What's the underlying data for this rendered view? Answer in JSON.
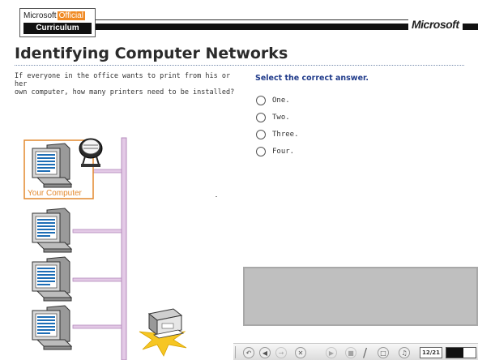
{
  "header": {
    "brand_top_ms": "Microsoft",
    "brand_top_official": "Official",
    "brand_curriculum": "Curriculum",
    "ms_logo": "Microsoft"
  },
  "page_title": "Identifying Computer Networks",
  "question": {
    "line1": "If everyone in the office wants to print from his or her",
    "line2": "own computer, how many printers need to be installed?"
  },
  "instruction": "Select the correct answer.",
  "options": [
    {
      "label": "One.",
      "selected": false
    },
    {
      "label": "Two.",
      "selected": false
    },
    {
      "label": "Three.",
      "selected": false
    },
    {
      "label": "Four.",
      "selected": false
    }
  ],
  "diagram": {
    "your_computer_label": "Your Computer",
    "highlight_color": "#e3892d",
    "network_line_color": "#c9a6cf",
    "burst_color": "#f6c623"
  },
  "toolbar": {
    "page_counter": "12/21",
    "progress_fraction": 0.57,
    "icons": [
      "back-icon",
      "home-icon",
      "forward-icon",
      "close-icon",
      "play-icon",
      "stop-icon",
      "pen-icon",
      "comment-icon",
      "audio-icon"
    ]
  }
}
